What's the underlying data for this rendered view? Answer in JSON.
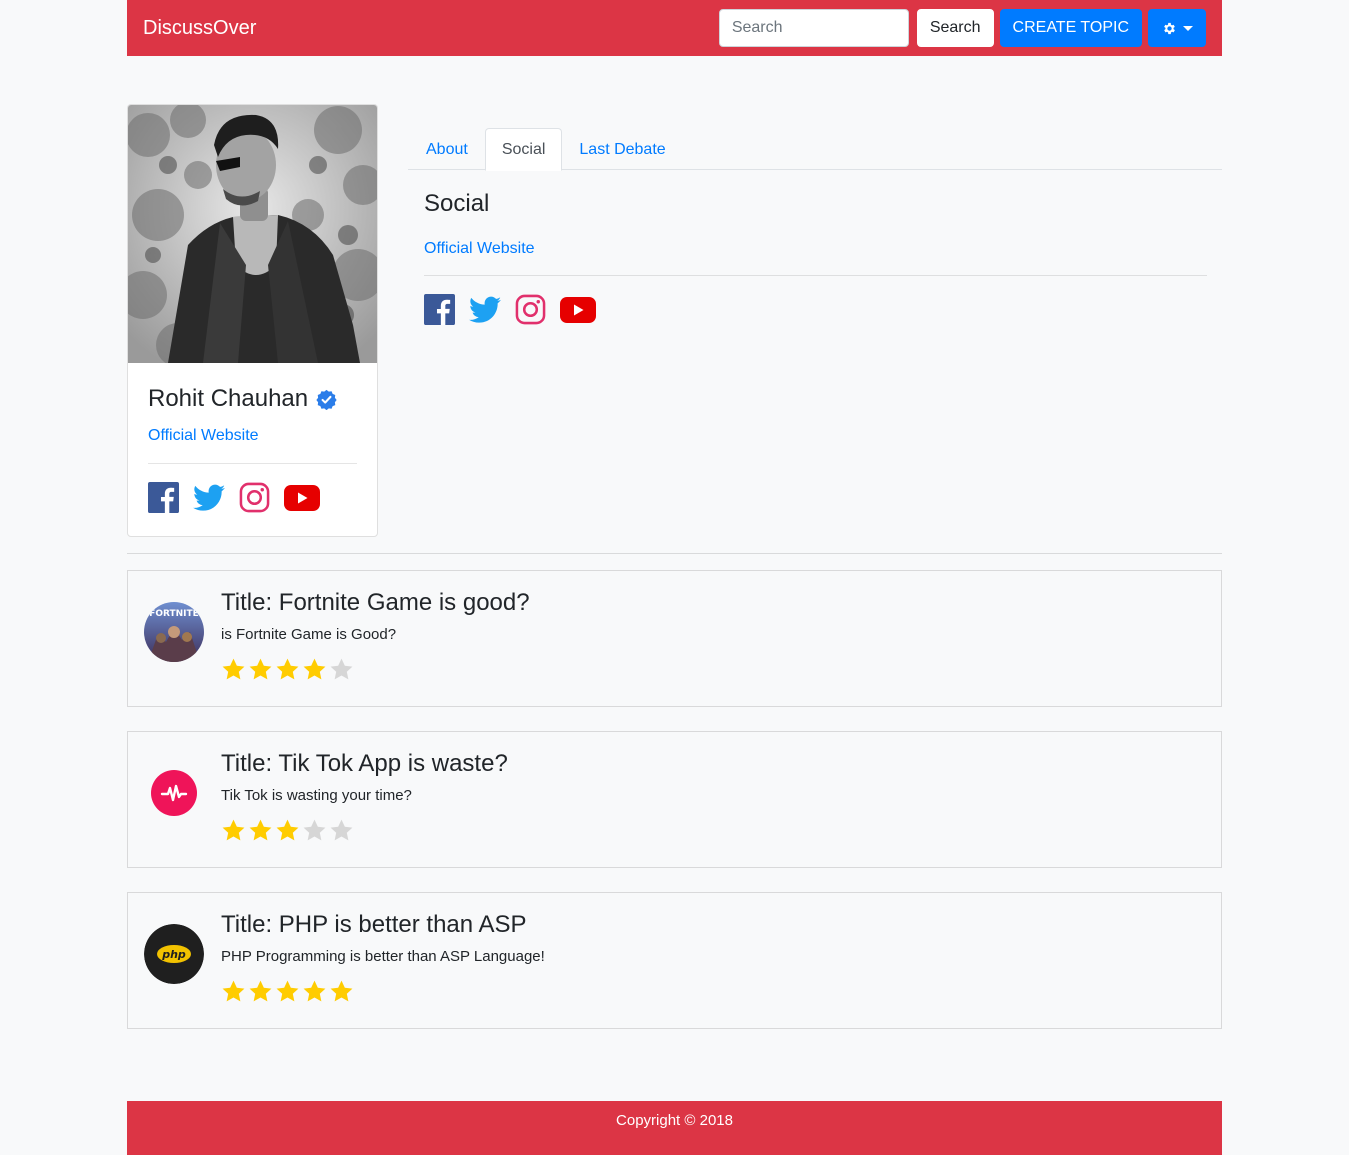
{
  "navbar": {
    "brand": "DiscussOver",
    "search_placeholder": "Search",
    "search_button": "Search",
    "create_button": "CREATE TOPIC",
    "settings_icon": "gear-icon"
  },
  "profile": {
    "name": "Rohit Chauhan",
    "verified": true,
    "website_label": "Official Website",
    "socials": [
      "facebook-icon",
      "twitter-icon",
      "instagram-icon",
      "youtube-icon"
    ]
  },
  "tabs": [
    {
      "label": "About",
      "active": false
    },
    {
      "label": "Social",
      "active": true
    },
    {
      "label": "Last Debate",
      "active": false
    }
  ],
  "social_section": {
    "title": "Social",
    "website_label": "Official Website"
  },
  "debates": [
    {
      "title": "Title: Fortnite Game is good?",
      "description": "is Fortnite Game is Good?",
      "rating": 4,
      "max_rating": 5,
      "thumb": "fortnite"
    },
    {
      "title": "Title: Tik Tok App is waste?",
      "description": "Tik Tok is wasting your time?",
      "rating": 3,
      "max_rating": 5,
      "thumb": "tiktok"
    },
    {
      "title": "Title: PHP is better than ASP",
      "description": "PHP Programming is better than ASP Language!",
      "rating": 5,
      "max_rating": 5,
      "thumb": "php"
    }
  ],
  "footer": {
    "copyright": "Copyright © 2018"
  },
  "colors": {
    "brand_red": "#dc3545",
    "primary": "#007bff",
    "star_on": "#ffcc00",
    "star_off": "#d6d6d6"
  }
}
